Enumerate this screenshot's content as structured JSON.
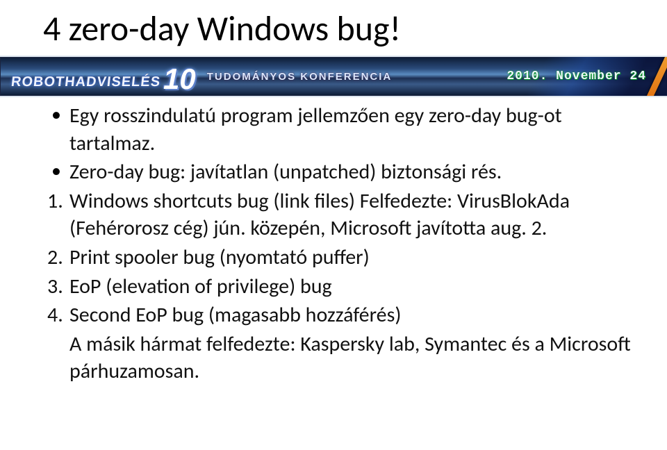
{
  "banner": {
    "brand_word": "ROBOTHADVISELÉS",
    "brand_number": "10",
    "subtitle": "Tudományos Konferencia",
    "date": "2010. November 24"
  },
  "title": "4 zero-day Windows bug!",
  "bullets": [
    "Egy rosszindulatú program jellemzően egy zero-day bug-ot tartalmaz.",
    "Zero-day bug: javítatlan (unpatched) biztonsági rés."
  ],
  "numbered": [
    "Windows shortcuts bug (link files) Felfedezte: VirusBlokAda (Fehérorosz cég) jún. közepén, Microsoft javította aug. 2.",
    "Print spooler bug (nyomtató puffer)",
    "EoP (elevation of privilege) bug",
    "Second EoP bug (magasabb hozzáférés)"
  ],
  "footer_text": "A másik hármat felfedezte: Kaspersky lab, Symantec és a Microsoft párhuzamosan."
}
